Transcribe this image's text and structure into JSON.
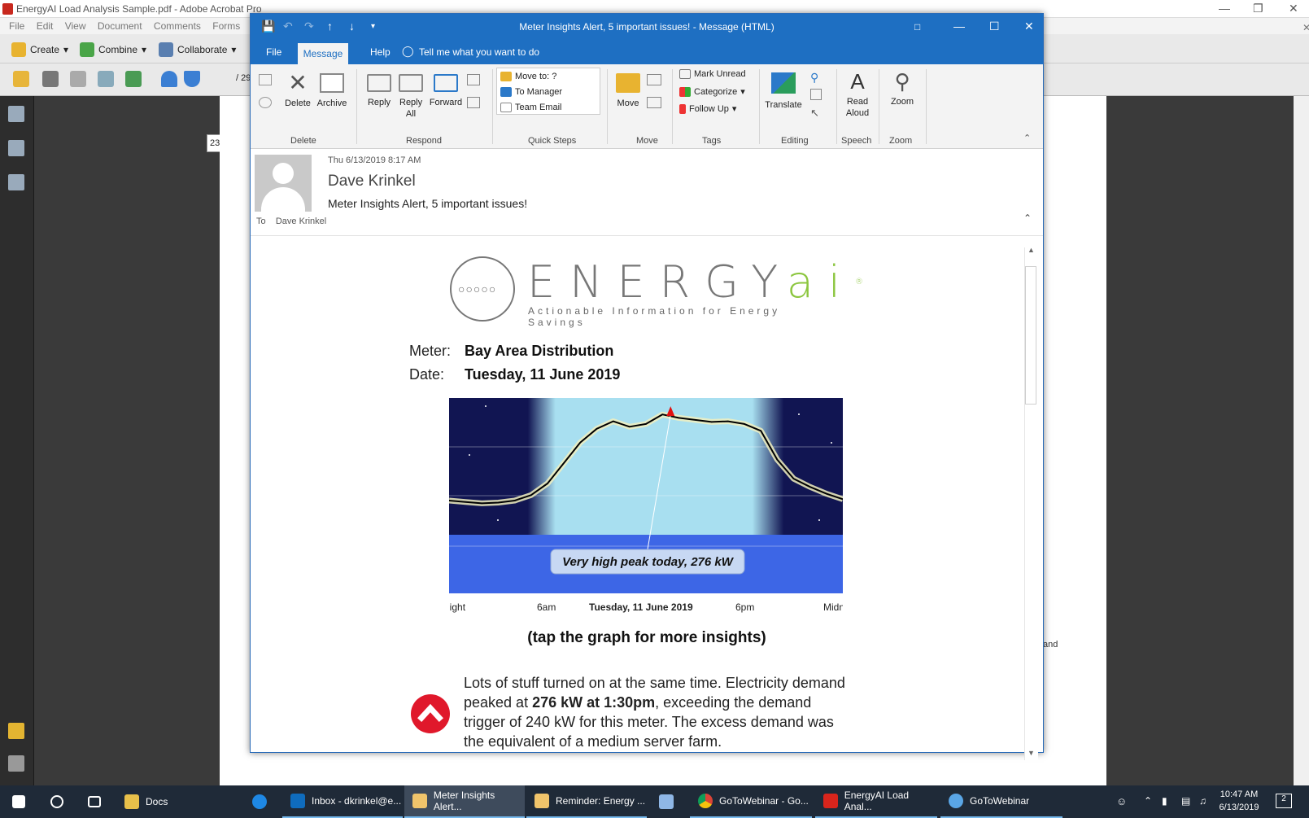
{
  "acrobat": {
    "title": "EnergyAI Load Analysis Sample.pdf - Adobe Acrobat Pro",
    "menu": [
      "File",
      "Edit",
      "View",
      "Document",
      "Comments",
      "Forms",
      "To"
    ],
    "toolbar": {
      "create": "Create",
      "combine": "Combine",
      "collaborate": "Collaborate"
    },
    "page_number": "23",
    "page_total": "/ 29",
    "side_text": "and"
  },
  "outlook": {
    "title": "Meter Insights Alert, 5 important issues!  -  Message (HTML)",
    "tabs": {
      "file": "File",
      "message": "Message",
      "help": "Help",
      "tell_me": "Tell me what you want to do"
    },
    "ribbon": {
      "delete": {
        "delete": "Delete",
        "archive": "Archive",
        "group": "Delete"
      },
      "respond": {
        "reply": "Reply",
        "reply_all": "Reply All",
        "forward": "Forward",
        "group": "Respond"
      },
      "quick_steps": {
        "items": [
          "Move to: ?",
          "To Manager",
          "Team Email"
        ],
        "group": "Quick Steps"
      },
      "move": {
        "move": "Move",
        "group": "Move"
      },
      "tags": {
        "mark_unread": "Mark Unread",
        "categorize": "Categorize",
        "follow_up": "Follow Up",
        "group": "Tags"
      },
      "editing": {
        "translate": "Translate",
        "group": "Editing"
      },
      "speech": {
        "read_aloud_1": "Read",
        "read_aloud_2": "Aloud",
        "group": "Speech"
      },
      "zoom": {
        "zoom": "Zoom",
        "group": "Zoom"
      }
    },
    "header": {
      "date": "Thu 6/13/2019 8:17 AM",
      "from": "Dave Krinkel",
      "subject": "Meter Insights Alert, 5 important issues!",
      "to_label": "To",
      "to": "Dave Krinkel"
    },
    "body": {
      "logo_word": "ENERGY",
      "logo_ai": "ai",
      "logo_reg": "®",
      "tagline": "Actionable Information for Energy Savings",
      "meter_label": "Meter:",
      "meter_value": "Bay Area Distribution",
      "date_label": "Date:",
      "date_value": "Tuesday, 11 June 2019",
      "tap": "(tap the graph for more insights)",
      "alert_line1": "Lots of stuff turned on at the same time. Electricity demand",
      "alert_line2_pre": "peaked at ",
      "alert_line2_bold": "276 kW at 1:30pm",
      "alert_line2_post": ", exceeding the demand",
      "alert_line3": "trigger of 240 kW for this meter. The excess demand was",
      "alert_line4": "the equivalent of a medium server farm."
    }
  },
  "chart_data": {
    "type": "line",
    "callout": "Very high peak today, 276 kW",
    "x_ticks": [
      "night",
      "6am",
      "Tuesday, 11 June 2019",
      "6pm",
      "Midn"
    ],
    "x_hours": [
      0,
      1,
      2,
      3,
      4,
      5,
      6,
      7,
      8,
      9,
      10,
      11,
      12,
      13,
      14,
      15,
      16,
      17,
      18,
      19,
      20,
      21,
      22,
      23,
      24
    ],
    "y_kw": [
      150,
      148,
      146,
      147,
      150,
      158,
      175,
      205,
      235,
      255,
      266,
      258,
      262,
      276,
      271,
      268,
      265,
      266,
      262,
      252,
      210,
      182,
      170,
      160,
      152
    ],
    "peak": {
      "hour": 13.5,
      "kw": 276
    },
    "colors": {
      "night": "#111552",
      "day": "#a8dff0",
      "band": "#3d66e6",
      "line": "#000000",
      "callout_bg": "#c7d8f3",
      "peak_marker": "#e01010"
    }
  },
  "taskbar": {
    "items": [
      {
        "label": "Docs",
        "icon": "folder-icon"
      },
      {
        "label": "Inbox - dkrinkel@e...",
        "icon": "outlook-icon"
      },
      {
        "label": "Meter Insights Alert...",
        "icon": "mail-icon"
      },
      {
        "label": "Reminder: Energy ...",
        "icon": "mail-icon"
      },
      {
        "label": "GoToWebinar - Go...",
        "icon": "chrome-icon"
      },
      {
        "label": "EnergyAI Load Anal...",
        "icon": "acrobat-icon"
      },
      {
        "label": "GoToWebinar",
        "icon": "gotowebinar-icon"
      }
    ],
    "time": "10:47 AM",
    "date": "6/13/2019",
    "notifications": "2"
  }
}
